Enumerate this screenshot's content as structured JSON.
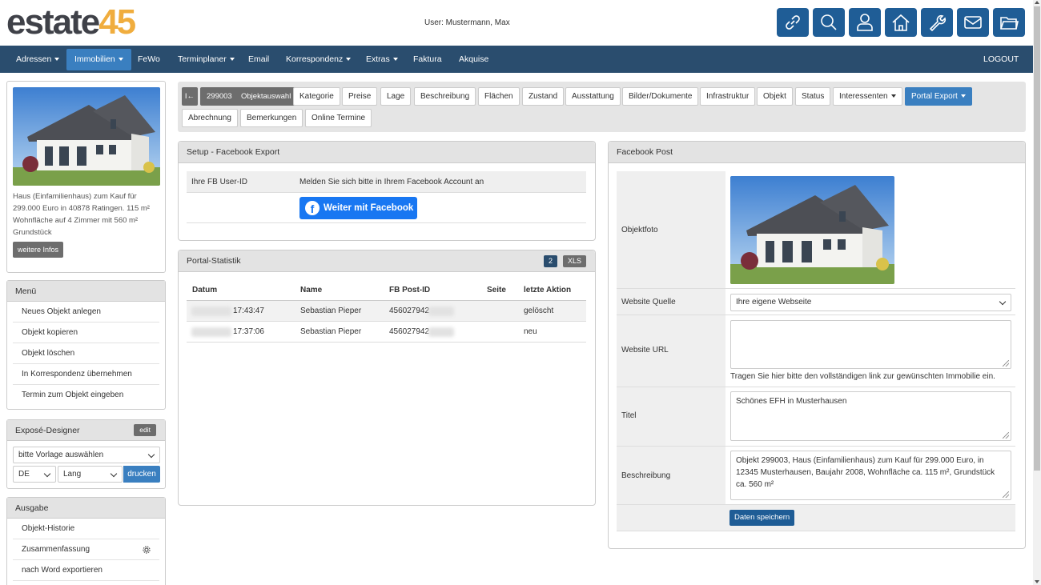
{
  "header": {
    "logo_part1": "estate",
    "logo_part2": "45",
    "user_label": "User: Mustermann, Max",
    "icons": [
      "link-icon",
      "search-icon",
      "user-icon",
      "home-icon",
      "wrench-icon",
      "mail-icon",
      "folder-icon"
    ]
  },
  "nav": {
    "items": [
      {
        "label": "Adressen",
        "dropdown": true
      },
      {
        "label": "Immobilien",
        "dropdown": true,
        "active": true
      },
      {
        "label": "FeWo",
        "dropdown": false
      },
      {
        "label": "Terminplaner",
        "dropdown": true
      },
      {
        "label": "Email",
        "dropdown": false
      },
      {
        "label": "Korrespondenz",
        "dropdown": true
      },
      {
        "label": "Extras",
        "dropdown": true
      },
      {
        "label": "Faktura",
        "dropdown": false
      },
      {
        "label": "Akquise",
        "dropdown": false
      }
    ],
    "logout": "LOGOUT"
  },
  "sidebar": {
    "property_desc": "Haus (Einfamilienhaus) zum Kauf für 299.000 Euro in 40878 Ratingen. 115 m² Wohnfläche auf 4 Zimmer mit 560 m² Grundstück",
    "more_info": "weitere Infos",
    "menu_title": "Menü",
    "menu_items": [
      "Neues Objekt anlegen",
      "Objekt kopieren",
      "Objekt löschen",
      "In Korrespondenz übernehmen",
      "Termin zum Objekt eingeben"
    ],
    "expose_title": "Exposé-Designer",
    "expose_edit": "edit",
    "template_select": "bitte Vorlage auswählen",
    "lang_select": "DE",
    "length_select": "Lang",
    "print_button": "drucken",
    "output_title": "Ausgabe",
    "output_items": [
      "Objekt-Historie",
      "Zusammenfassung",
      "nach Word exportieren"
    ]
  },
  "tabs": {
    "back_symbol": "I←",
    "object_id": "299003",
    "row1": [
      "Objektauswahl",
      "Kategorie",
      "Preise",
      "Lage",
      "Beschreibung",
      "Flächen",
      "Zustand",
      "Ausstattung",
      "Bilder/Dokumente",
      "Infrastruktur",
      "Objekt",
      "Status",
      "Interessenten",
      "Portal Export"
    ],
    "row2": [
      "Abrechnung",
      "Bemerkungen",
      "Online Termine"
    ]
  },
  "setup": {
    "title": "Setup - Facebook Export",
    "fb_user_label": "Ihre FB User-ID",
    "fb_user_value": "Melden Sie sich bitte in Ihrem Facebook Account an",
    "fb_button": "Weiter mit Facebook"
  },
  "stats": {
    "title": "Portal-Statistik",
    "count": "2",
    "xls": "XLS",
    "columns": [
      "Datum",
      "Name",
      "FB Post-ID",
      "Seite",
      "letzte Aktion"
    ],
    "rows": [
      {
        "datum": "17:43:47",
        "name": "Sebastian Pieper",
        "post_id": "456027942",
        "seite": "",
        "aktion": "gelöscht"
      },
      {
        "datum": "17:37:06",
        "name": "Sebastian Pieper",
        "post_id": "456027942",
        "seite": "",
        "aktion": "neu"
      }
    ]
  },
  "post": {
    "title": "Facebook Post",
    "photo_label": "Objektfoto",
    "source_label": "Website Quelle",
    "source_value": "Ihre eigene Webseite",
    "url_label": "Website URL",
    "url_value": "",
    "url_hint": "Tragen Sie hier bitte den vollständigen link zur gewünschten Immobilie ein.",
    "title_label": "Titel",
    "title_value": "Schönes EFH in Musterhausen",
    "desc_label": "Beschreibung",
    "desc_value": "Objekt 299003, Haus (Einfamilienhaus)  zum Kauf für 299.000 Euro, in 12345 Musterhausen, Baujahr 2008, Wohnfläche ca. 115 m², Grundstück ca. 560 m²",
    "save_button": "Daten speichern"
  }
}
